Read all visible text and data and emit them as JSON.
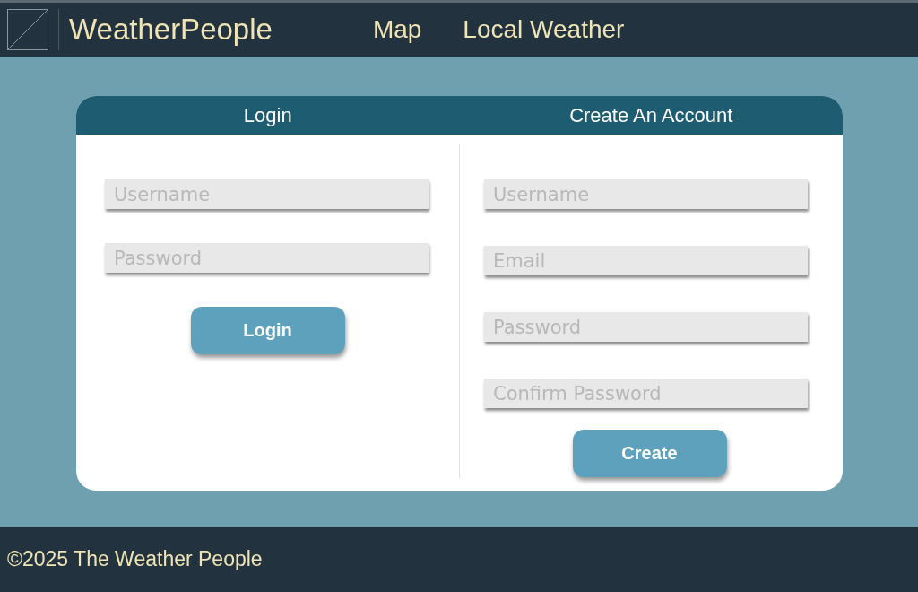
{
  "header": {
    "title": "WeatherPeople",
    "nav": [
      {
        "label": "Map"
      },
      {
        "label": "Local Weather"
      }
    ]
  },
  "panels": [
    {
      "heading": "Login",
      "fields": [
        {
          "placeholder": "Username"
        },
        {
          "placeholder": "Password"
        }
      ],
      "button": "Login"
    },
    {
      "heading": "Create An Account",
      "fields": [
        {
          "placeholder": "Username"
        },
        {
          "placeholder": "Email"
        },
        {
          "placeholder": "Password"
        },
        {
          "placeholder": "Confirm Password"
        }
      ],
      "button": "Create"
    }
  ],
  "footer": {
    "text": "©2025 The Weather People"
  }
}
